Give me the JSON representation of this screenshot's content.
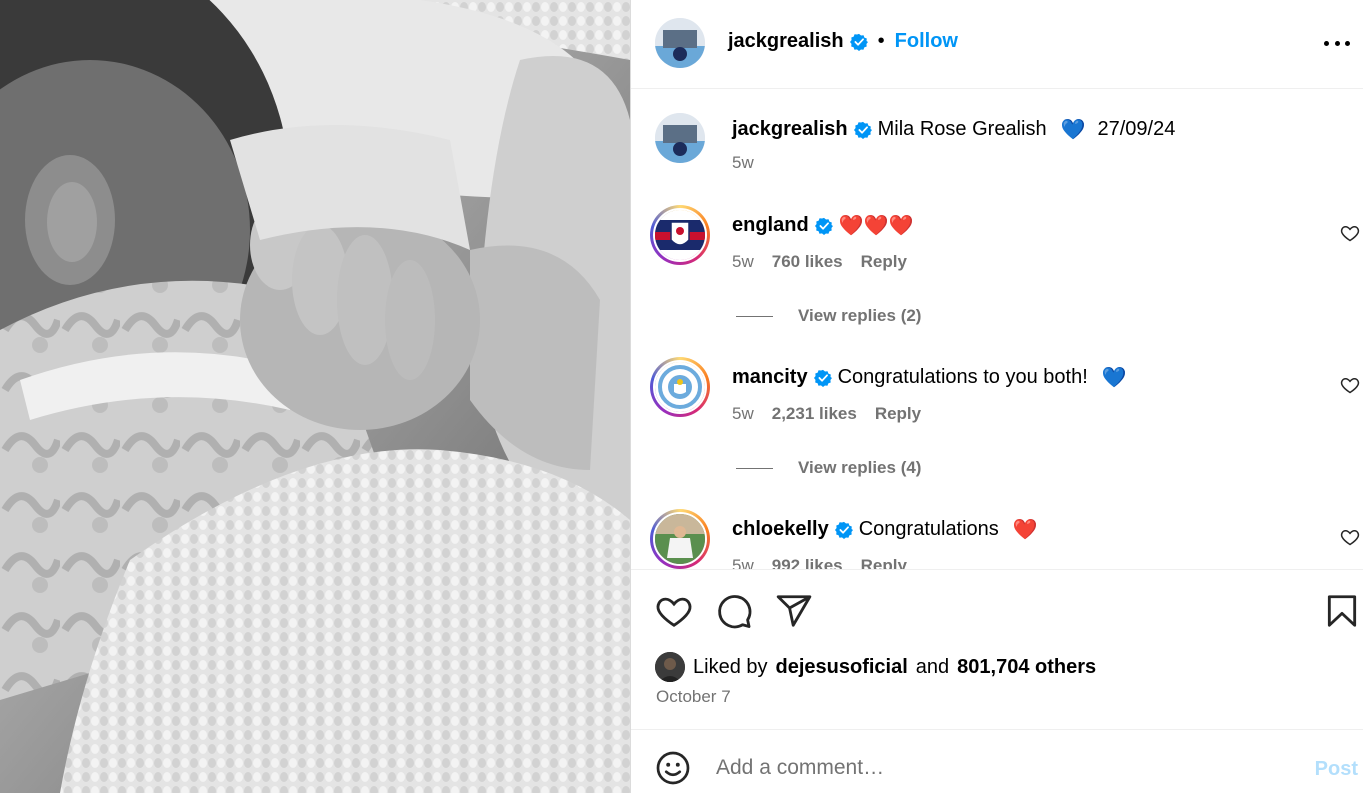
{
  "post": {
    "username": "jackgrealish",
    "follow_label": "Follow",
    "separator": "•",
    "caption": "Mila Rose Grealish",
    "caption_emoji": "💙",
    "caption_date": "27/09/24",
    "caption_age": "5w"
  },
  "comments": [
    {
      "username": "england",
      "text": "",
      "emoji": "❤️❤️❤️",
      "age": "5w",
      "likes": "760 likes",
      "reply": "Reply",
      "view_replies": "View replies (2)"
    },
    {
      "username": "mancity",
      "text": "Congratulations to you both!",
      "emoji": "💙",
      "age": "5w",
      "likes": "2,231 likes",
      "reply": "Reply",
      "view_replies": "View replies (4)"
    },
    {
      "username": "chloekelly",
      "text": "Congratulations",
      "emoji": "❤️",
      "age": "5w",
      "likes": "992 likes",
      "reply": "Reply"
    }
  ],
  "likes": {
    "prefix": "Liked by",
    "liker": "dejesusoficial",
    "and": "and",
    "others": "801,704 others"
  },
  "post_date": "October 7",
  "comment_box": {
    "placeholder": "Add a comment…",
    "post_label": "Post"
  },
  "icons": {
    "verified": "verified-badge-icon",
    "more": "more-options-icon",
    "like": "heart-icon",
    "comment": "comment-icon",
    "share": "share-icon",
    "save": "bookmark-icon",
    "emoji": "emoji-icon"
  },
  "colors": {
    "accent": "#0095f6",
    "muted": "#737373",
    "post_disabled": "#b3dffc",
    "verified": "#0095f6"
  }
}
